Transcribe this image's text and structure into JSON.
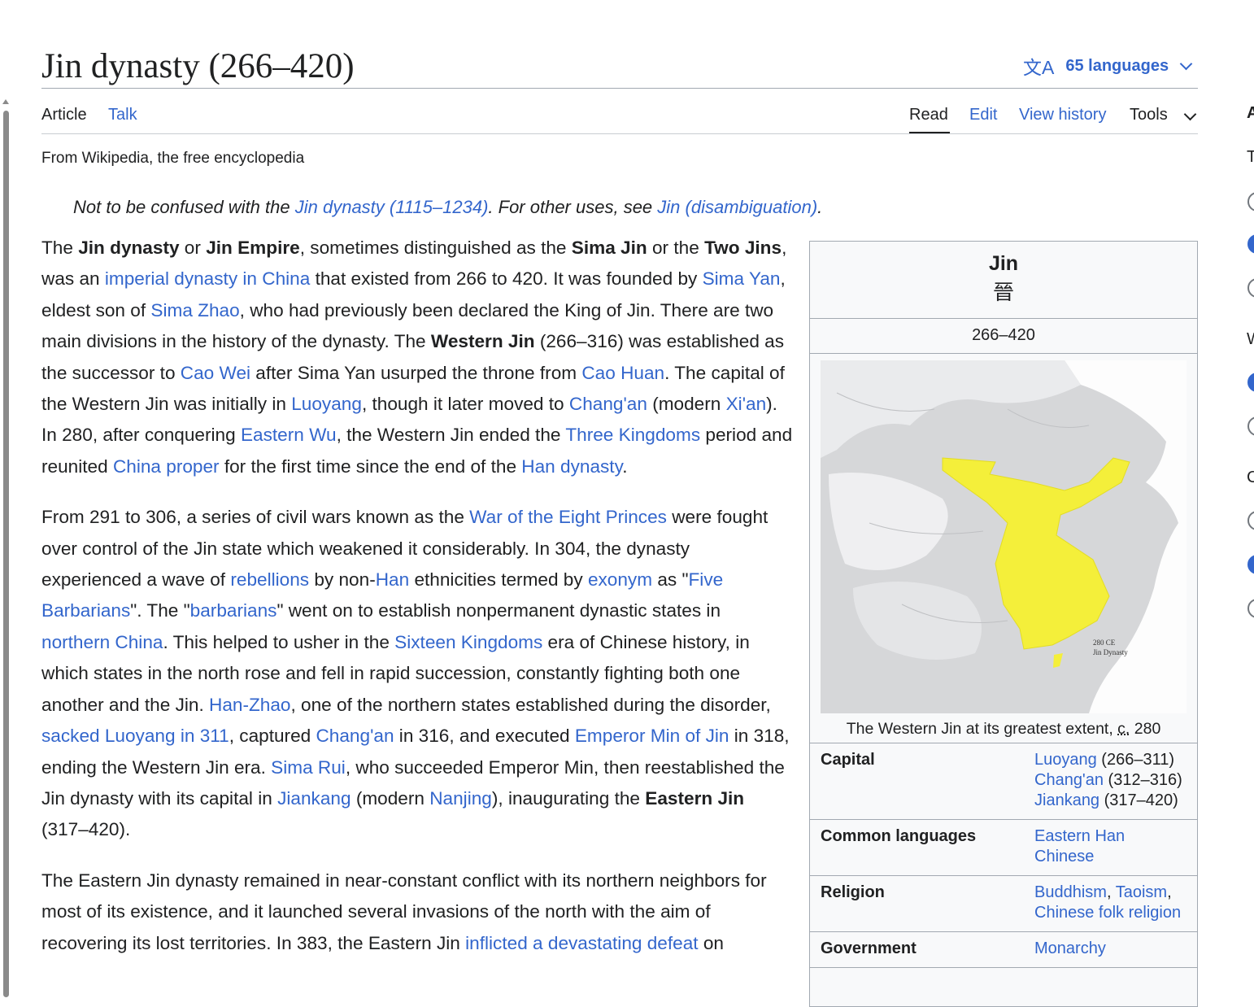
{
  "page": {
    "title": "Jin dynasty (266–420)",
    "languages_label": "65 languages",
    "tagline": "From Wikipedia, the free encyclopedia"
  },
  "icons": {
    "translate": "translate-icon",
    "chevron": "chevron-down-icon"
  },
  "tabs": {
    "article": "Article",
    "talk": "Talk",
    "read": "Read",
    "edit": "Edit",
    "view_history": "View history",
    "tools": "Tools"
  },
  "hatnote": {
    "prefix": "Not to be confused with the ",
    "link1": "Jin dynasty (1115–1234)",
    "middle": ". For other uses, see ",
    "link2": "Jin (disambiguation)",
    "suffix": "."
  },
  "p1": [
    {
      "t": "The "
    },
    {
      "t": "Jin dynasty",
      "b": 1
    },
    {
      "t": " or "
    },
    {
      "t": "Jin Empire",
      "b": 1
    },
    {
      "t": ", sometimes distinguished as the "
    },
    {
      "t": "Sima Jin",
      "b": 1
    },
    {
      "t": " or the "
    },
    {
      "t": "Two Jins",
      "b": 1
    },
    {
      "t": ", was an "
    },
    {
      "t": "imperial dynasty in China",
      "l": 1
    },
    {
      "t": " that existed from 266 to 420. It was founded by "
    },
    {
      "t": "Sima Yan",
      "l": 1
    },
    {
      "t": ", eldest son of "
    },
    {
      "t": "Sima Zhao",
      "l": 1
    },
    {
      "t": ", who had previously been declared the King of Jin. There are two main divisions in the history of the dynasty. The "
    },
    {
      "t": "Western Jin",
      "b": 1
    },
    {
      "t": " (266–316) was established as the successor to "
    },
    {
      "t": "Cao Wei",
      "l": 1
    },
    {
      "t": " after Sima Yan usurped the throne from "
    },
    {
      "t": "Cao Huan",
      "l": 1
    },
    {
      "t": ". The capital of the Western Jin was initially in "
    },
    {
      "t": "Luoyang",
      "l": 1
    },
    {
      "t": ", though it later moved to "
    },
    {
      "t": "Chang'an",
      "l": 1
    },
    {
      "t": " (modern "
    },
    {
      "t": "Xi'an",
      "l": 1
    },
    {
      "t": "). In 280, after conquering "
    },
    {
      "t": "Eastern Wu",
      "l": 1
    },
    {
      "t": ", the Western Jin ended the "
    },
    {
      "t": "Three Kingdoms",
      "l": 1
    },
    {
      "t": " period and reunited "
    },
    {
      "t": "China proper",
      "l": 1
    },
    {
      "t": " for the first time since the end of the "
    },
    {
      "t": "Han dynasty",
      "l": 1
    },
    {
      "t": "."
    }
  ],
  "p2": [
    {
      "t": "From 291 to 306, a series of civil wars known as the "
    },
    {
      "t": "War of the Eight Princes",
      "l": 1
    },
    {
      "t": " were fought over control of the Jin state which weakened it considerably. In 304, the dynasty experienced a wave of "
    },
    {
      "t": "rebellions",
      "l": 1
    },
    {
      "t": " by non-"
    },
    {
      "t": "Han",
      "l": 1
    },
    {
      "t": " ethnicities termed by "
    },
    {
      "t": "exonym",
      "l": 1
    },
    {
      "t": " as \""
    },
    {
      "t": "Five Barbarians",
      "l": 1
    },
    {
      "t": "\". The \""
    },
    {
      "t": "barbarians",
      "l": 1
    },
    {
      "t": "\" went on to establish nonpermanent dynastic states in "
    },
    {
      "t": "northern China",
      "l": 1
    },
    {
      "t": ". This helped to usher in the "
    },
    {
      "t": "Sixteen Kingdoms",
      "l": 1
    },
    {
      "t": " era of Chinese history, in which states in the north rose and fell in rapid succession, constantly fighting both one another and the Jin. "
    },
    {
      "t": "Han-Zhao",
      "l": 1
    },
    {
      "t": ", one of the northern states established during the disorder, "
    },
    {
      "t": "sacked Luoyang in 311",
      "l": 1
    },
    {
      "t": ", captured "
    },
    {
      "t": "Chang'an",
      "l": 1
    },
    {
      "t": " in 316, and executed "
    },
    {
      "t": "Emperor Min of Jin",
      "l": 1
    },
    {
      "t": " in 318, ending the Western Jin era. "
    },
    {
      "t": "Sima Rui",
      "l": 1
    },
    {
      "t": ", who succeeded Emperor Min, then reestablished the Jin dynasty with its capital in "
    },
    {
      "t": "Jiankang",
      "l": 1
    },
    {
      "t": " (modern "
    },
    {
      "t": "Nanjing",
      "l": 1
    },
    {
      "t": "), inaugurating the "
    },
    {
      "t": "Eastern Jin",
      "b": 1
    },
    {
      "t": " (317–420)."
    }
  ],
  "p3": [
    {
      "t": "The Eastern Jin dynasty remained in near-constant conflict with its northern neighbors for most of its existence, and it launched several invasions of the north with the aim of recovering its lost territories. In 383, the Eastern Jin "
    },
    {
      "t": "inflicted a devastating defeat",
      "l": 1
    },
    {
      "t": " on"
    }
  ],
  "infobox": {
    "name": "Jin",
    "native": "晉",
    "years": "266–420",
    "map_label_1": "280 CE",
    "map_label_2": "Jin Dynasty",
    "caption_prefix": "The Western Jin at its greatest extent, ",
    "caption_circa": "c.",
    "caption_suffix": " 280",
    "colors": {
      "territory": "#f4ef3a",
      "sea": "#ffffff",
      "land": "#d9dadc"
    },
    "rows": [
      {
        "label": "Capital",
        "value": [
          {
            "t": "Luoyang",
            "l": 1
          },
          {
            "t": " (266–311) "
          },
          {
            "t": "Chang'an",
            "l": 1
          },
          {
            "t": " (312–316) "
          },
          {
            "t": "Jiankang",
            "l": 1
          },
          {
            "t": " (317–420)"
          }
        ]
      },
      {
        "label": "Common languages",
        "value": [
          {
            "t": "Eastern Han Chinese",
            "l": 1
          }
        ]
      },
      {
        "label": "Religion",
        "value": [
          {
            "t": "Buddhism",
            "l": 1
          },
          {
            "t": ", "
          },
          {
            "t": "Taoism",
            "l": 1
          },
          {
            "t": ", "
          },
          {
            "t": "Chinese folk religion",
            "l": 1
          }
        ]
      },
      {
        "label": "Government",
        "value": [
          {
            "t": "Monarchy",
            "l": 1
          }
        ]
      }
    ]
  },
  "sidebar": {
    "letters": [
      "A",
      "T",
      "W",
      "C"
    ]
  }
}
